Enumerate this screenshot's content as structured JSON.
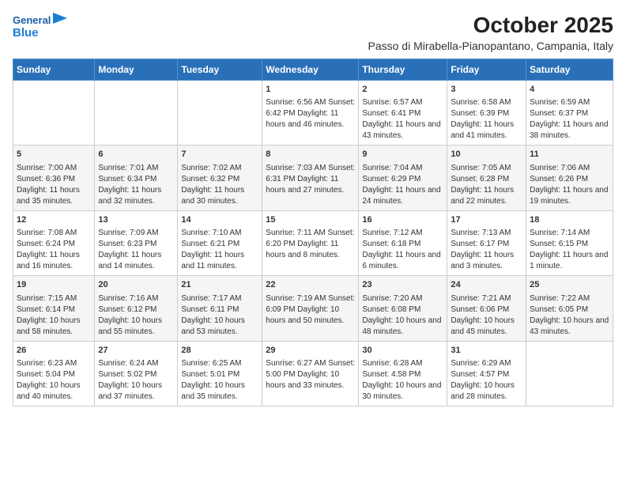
{
  "logo": {
    "line1": "General",
    "line2": "Blue"
  },
  "title": "October 2025",
  "subtitle": "Passo di Mirabella-Pianopantano, Campania, Italy",
  "days_of_week": [
    "Sunday",
    "Monday",
    "Tuesday",
    "Wednesday",
    "Thursday",
    "Friday",
    "Saturday"
  ],
  "weeks": [
    [
      {
        "num": "",
        "content": ""
      },
      {
        "num": "",
        "content": ""
      },
      {
        "num": "",
        "content": ""
      },
      {
        "num": "1",
        "content": "Sunrise: 6:56 AM\nSunset: 6:42 PM\nDaylight: 11 hours and 46 minutes."
      },
      {
        "num": "2",
        "content": "Sunrise: 6:57 AM\nSunset: 6:41 PM\nDaylight: 11 hours and 43 minutes."
      },
      {
        "num": "3",
        "content": "Sunrise: 6:58 AM\nSunset: 6:39 PM\nDaylight: 11 hours and 41 minutes."
      },
      {
        "num": "4",
        "content": "Sunrise: 6:59 AM\nSunset: 6:37 PM\nDaylight: 11 hours and 38 minutes."
      }
    ],
    [
      {
        "num": "5",
        "content": "Sunrise: 7:00 AM\nSunset: 6:36 PM\nDaylight: 11 hours and 35 minutes."
      },
      {
        "num": "6",
        "content": "Sunrise: 7:01 AM\nSunset: 6:34 PM\nDaylight: 11 hours and 32 minutes."
      },
      {
        "num": "7",
        "content": "Sunrise: 7:02 AM\nSunset: 6:32 PM\nDaylight: 11 hours and 30 minutes."
      },
      {
        "num": "8",
        "content": "Sunrise: 7:03 AM\nSunset: 6:31 PM\nDaylight: 11 hours and 27 minutes."
      },
      {
        "num": "9",
        "content": "Sunrise: 7:04 AM\nSunset: 6:29 PM\nDaylight: 11 hours and 24 minutes."
      },
      {
        "num": "10",
        "content": "Sunrise: 7:05 AM\nSunset: 6:28 PM\nDaylight: 11 hours and 22 minutes."
      },
      {
        "num": "11",
        "content": "Sunrise: 7:06 AM\nSunset: 6:26 PM\nDaylight: 11 hours and 19 minutes."
      }
    ],
    [
      {
        "num": "12",
        "content": "Sunrise: 7:08 AM\nSunset: 6:24 PM\nDaylight: 11 hours and 16 minutes."
      },
      {
        "num": "13",
        "content": "Sunrise: 7:09 AM\nSunset: 6:23 PM\nDaylight: 11 hours and 14 minutes."
      },
      {
        "num": "14",
        "content": "Sunrise: 7:10 AM\nSunset: 6:21 PM\nDaylight: 11 hours and 11 minutes."
      },
      {
        "num": "15",
        "content": "Sunrise: 7:11 AM\nSunset: 6:20 PM\nDaylight: 11 hours and 8 minutes."
      },
      {
        "num": "16",
        "content": "Sunrise: 7:12 AM\nSunset: 6:18 PM\nDaylight: 11 hours and 6 minutes."
      },
      {
        "num": "17",
        "content": "Sunrise: 7:13 AM\nSunset: 6:17 PM\nDaylight: 11 hours and 3 minutes."
      },
      {
        "num": "18",
        "content": "Sunrise: 7:14 AM\nSunset: 6:15 PM\nDaylight: 11 hours and 1 minute."
      }
    ],
    [
      {
        "num": "19",
        "content": "Sunrise: 7:15 AM\nSunset: 6:14 PM\nDaylight: 10 hours and 58 minutes."
      },
      {
        "num": "20",
        "content": "Sunrise: 7:16 AM\nSunset: 6:12 PM\nDaylight: 10 hours and 55 minutes."
      },
      {
        "num": "21",
        "content": "Sunrise: 7:17 AM\nSunset: 6:11 PM\nDaylight: 10 hours and 53 minutes."
      },
      {
        "num": "22",
        "content": "Sunrise: 7:19 AM\nSunset: 6:09 PM\nDaylight: 10 hours and 50 minutes."
      },
      {
        "num": "23",
        "content": "Sunrise: 7:20 AM\nSunset: 6:08 PM\nDaylight: 10 hours and 48 minutes."
      },
      {
        "num": "24",
        "content": "Sunrise: 7:21 AM\nSunset: 6:06 PM\nDaylight: 10 hours and 45 minutes."
      },
      {
        "num": "25",
        "content": "Sunrise: 7:22 AM\nSunset: 6:05 PM\nDaylight: 10 hours and 43 minutes."
      }
    ],
    [
      {
        "num": "26",
        "content": "Sunrise: 6:23 AM\nSunset: 5:04 PM\nDaylight: 10 hours and 40 minutes."
      },
      {
        "num": "27",
        "content": "Sunrise: 6:24 AM\nSunset: 5:02 PM\nDaylight: 10 hours and 37 minutes."
      },
      {
        "num": "28",
        "content": "Sunrise: 6:25 AM\nSunset: 5:01 PM\nDaylight: 10 hours and 35 minutes."
      },
      {
        "num": "29",
        "content": "Sunrise: 6:27 AM\nSunset: 5:00 PM\nDaylight: 10 hours and 33 minutes."
      },
      {
        "num": "30",
        "content": "Sunrise: 6:28 AM\nSunset: 4:58 PM\nDaylight: 10 hours and 30 minutes."
      },
      {
        "num": "31",
        "content": "Sunrise: 6:29 AM\nSunset: 4:57 PM\nDaylight: 10 hours and 28 minutes."
      },
      {
        "num": "",
        "content": ""
      }
    ]
  ]
}
